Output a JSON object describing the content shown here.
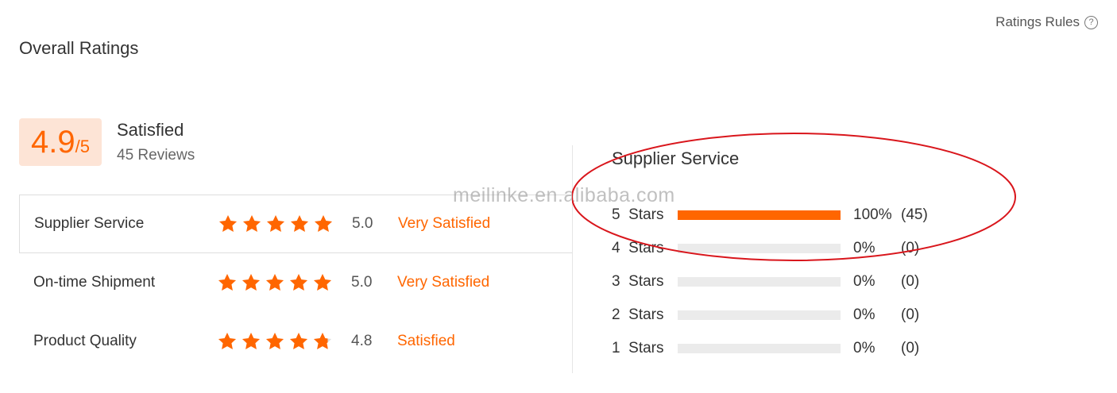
{
  "header": {
    "title": "Overall Ratings",
    "rules_label": "Ratings Rules",
    "rules_icon": "question-circle-icon"
  },
  "summary": {
    "score": "4.9",
    "scale": "/5",
    "satisfaction": "Satisfied",
    "reviews": "45 Reviews"
  },
  "categories": [
    {
      "label": "Supplier Service",
      "score": "5.0",
      "rating": 5.0,
      "level": "Very Satisfied",
      "selected": true
    },
    {
      "label": "On-time Shipment",
      "score": "5.0",
      "rating": 5.0,
      "level": "Very Satisfied",
      "selected": false
    },
    {
      "label": "Product Quality",
      "score": "4.8",
      "rating": 4.8,
      "level": "Satisfied",
      "selected": false
    }
  ],
  "distribution": {
    "title": "Supplier Service",
    "rows": [
      {
        "stars": "5",
        "unit": "Stars",
        "percent": "100%",
        "fraction": 1.0,
        "count": "(45)"
      },
      {
        "stars": "4",
        "unit": "Stars",
        "percent": "0%",
        "fraction": 0,
        "count": "(0)"
      },
      {
        "stars": "3",
        "unit": "Stars",
        "percent": "0%",
        "fraction": 0,
        "count": "(0)"
      },
      {
        "stars": "2",
        "unit": "Stars",
        "percent": "0%",
        "fraction": 0,
        "count": "(0)"
      },
      {
        "stars": "1",
        "unit": "Stars",
        "percent": "0%",
        "fraction": 0,
        "count": "(0)"
      }
    ]
  },
  "watermark": "meilinke.en.alibaba.com",
  "colors": {
    "accent": "#ff6600",
    "score_bg": "#fde4d6",
    "bar_track": "#ebebeb",
    "annotation": "#d9161c"
  }
}
